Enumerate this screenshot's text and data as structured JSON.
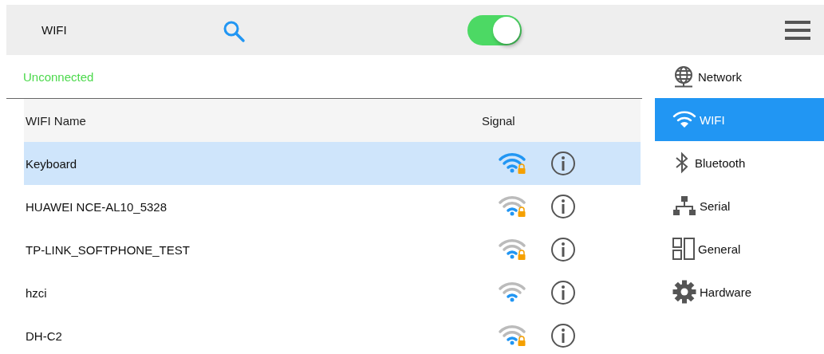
{
  "top_bar": {
    "title": "WIFI",
    "wifi_on": true
  },
  "status": "Unconnected",
  "table": {
    "columns": [
      "WIFI Name",
      "Signal"
    ],
    "rows": [
      {
        "name": "Keyboard",
        "secured": true,
        "selected": true
      },
      {
        "name": "HUAWEI NCE-AL10_5328",
        "secured": true,
        "selected": false
      },
      {
        "name": "TP-LINK_SOFTPHONE_TEST",
        "secured": true,
        "selected": false
      },
      {
        "name": "hzci",
        "secured": false,
        "selected": false
      },
      {
        "name": "DH-C2",
        "secured": true,
        "selected": false
      }
    ]
  },
  "sidebar": {
    "items": [
      {
        "label": "Network",
        "kind": "globe",
        "selected": false
      },
      {
        "label": "WIFI",
        "kind": "wifi",
        "selected": true
      },
      {
        "label": "Bluetooth",
        "kind": "bluetooth",
        "selected": false
      },
      {
        "label": "Serial",
        "kind": "network",
        "selected": false
      },
      {
        "label": "General",
        "kind": "layout",
        "selected": false
      },
      {
        "label": "Hardware",
        "kind": "gear",
        "selected": false
      }
    ]
  }
}
